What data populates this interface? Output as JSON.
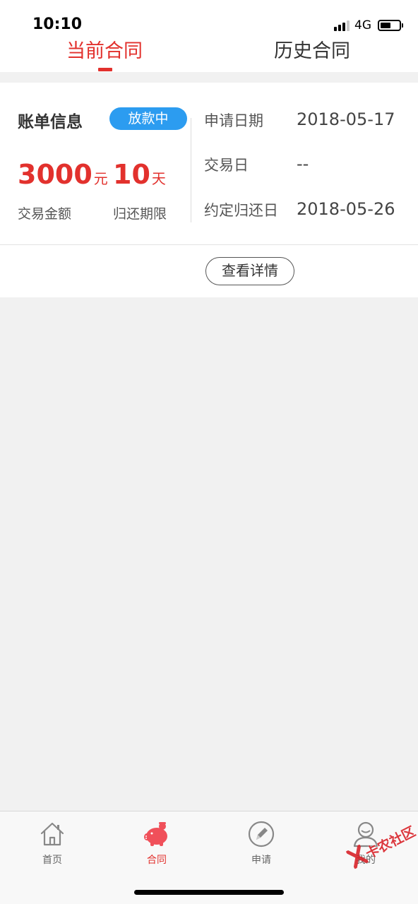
{
  "status_bar": {
    "time": "10:10",
    "network": "4G",
    "icons": [
      "signal-icon",
      "battery-icon"
    ]
  },
  "tabs": [
    {
      "label": "当前合同",
      "active": true
    },
    {
      "label": "历史合同",
      "active": false
    }
  ],
  "contract": {
    "title": "账单信息",
    "status": "放款中",
    "amount": {
      "value": "3000",
      "unit": "元",
      "label": "交易金额"
    },
    "term": {
      "value": "10",
      "unit": "天",
      "label": "归还期限"
    },
    "info": [
      {
        "label": "申请日期",
        "value": "2018-05-17"
      },
      {
        "label": "交易日",
        "value": "--"
      },
      {
        "label": "约定归还日",
        "value": "2018-05-26"
      }
    ],
    "detail_button": "查看详情"
  },
  "bottom_nav": [
    {
      "label": "首页",
      "icon": "home-icon",
      "active": false
    },
    {
      "label": "合同",
      "icon": "piggy-bank-icon",
      "active": true
    },
    {
      "label": "申请",
      "icon": "pencil-icon",
      "active": false
    },
    {
      "label": "我的",
      "icon": "user-icon",
      "active": false
    }
  ],
  "watermark": {
    "text": "卡农社区",
    "icon": "watermark-logo-icon"
  },
  "colors": {
    "accent": "#e2312d",
    "badge": "#2c9cf0",
    "background": "#f1f1f1"
  }
}
